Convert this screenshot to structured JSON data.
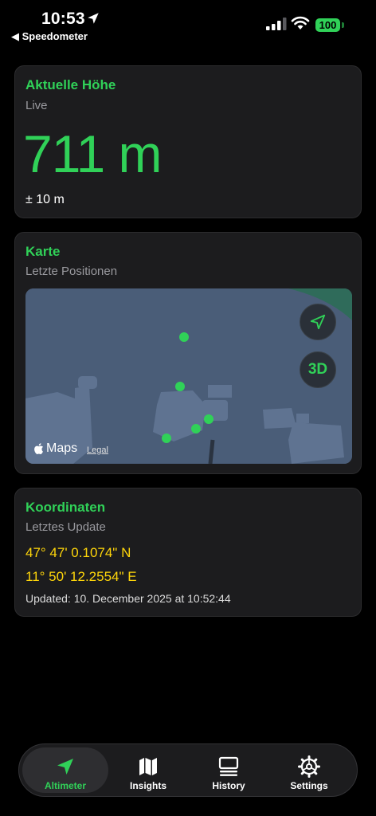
{
  "status_bar": {
    "time": "10:53",
    "back_label": "◀ Speedometer",
    "battery": "100"
  },
  "altitude_card": {
    "title": "Aktuelle Höhe",
    "subtitle": "Live",
    "value": "711 m",
    "accuracy": "± 10 m"
  },
  "map_card": {
    "title": "Karte",
    "subtitle": "Letzte Positionen",
    "btn_3d": "3D",
    "maps_label": "Maps",
    "legal": "Legal"
  },
  "coords_card": {
    "title": "Koordinaten",
    "subtitle": "Letztes Update",
    "latitude": "47° 47' 0.1074\" N",
    "longitude": "11° 50' 12.2554\" E",
    "updated": "Updated: 10. December 2025 at 10:52:44"
  },
  "tabs": [
    {
      "label": "Altimeter",
      "icon": "location-arrow-icon",
      "active": true
    },
    {
      "label": "Insights",
      "icon": "map-icon",
      "active": false
    },
    {
      "label": "History",
      "icon": "history-icon",
      "active": false
    },
    {
      "label": "Settings",
      "icon": "gear-icon",
      "active": false
    }
  ],
  "colors": {
    "accent_green": "#30d158",
    "coordinate_yellow": "#ffd60a",
    "card_background": "#1c1c1e",
    "map_water": "#4a5d78"
  }
}
